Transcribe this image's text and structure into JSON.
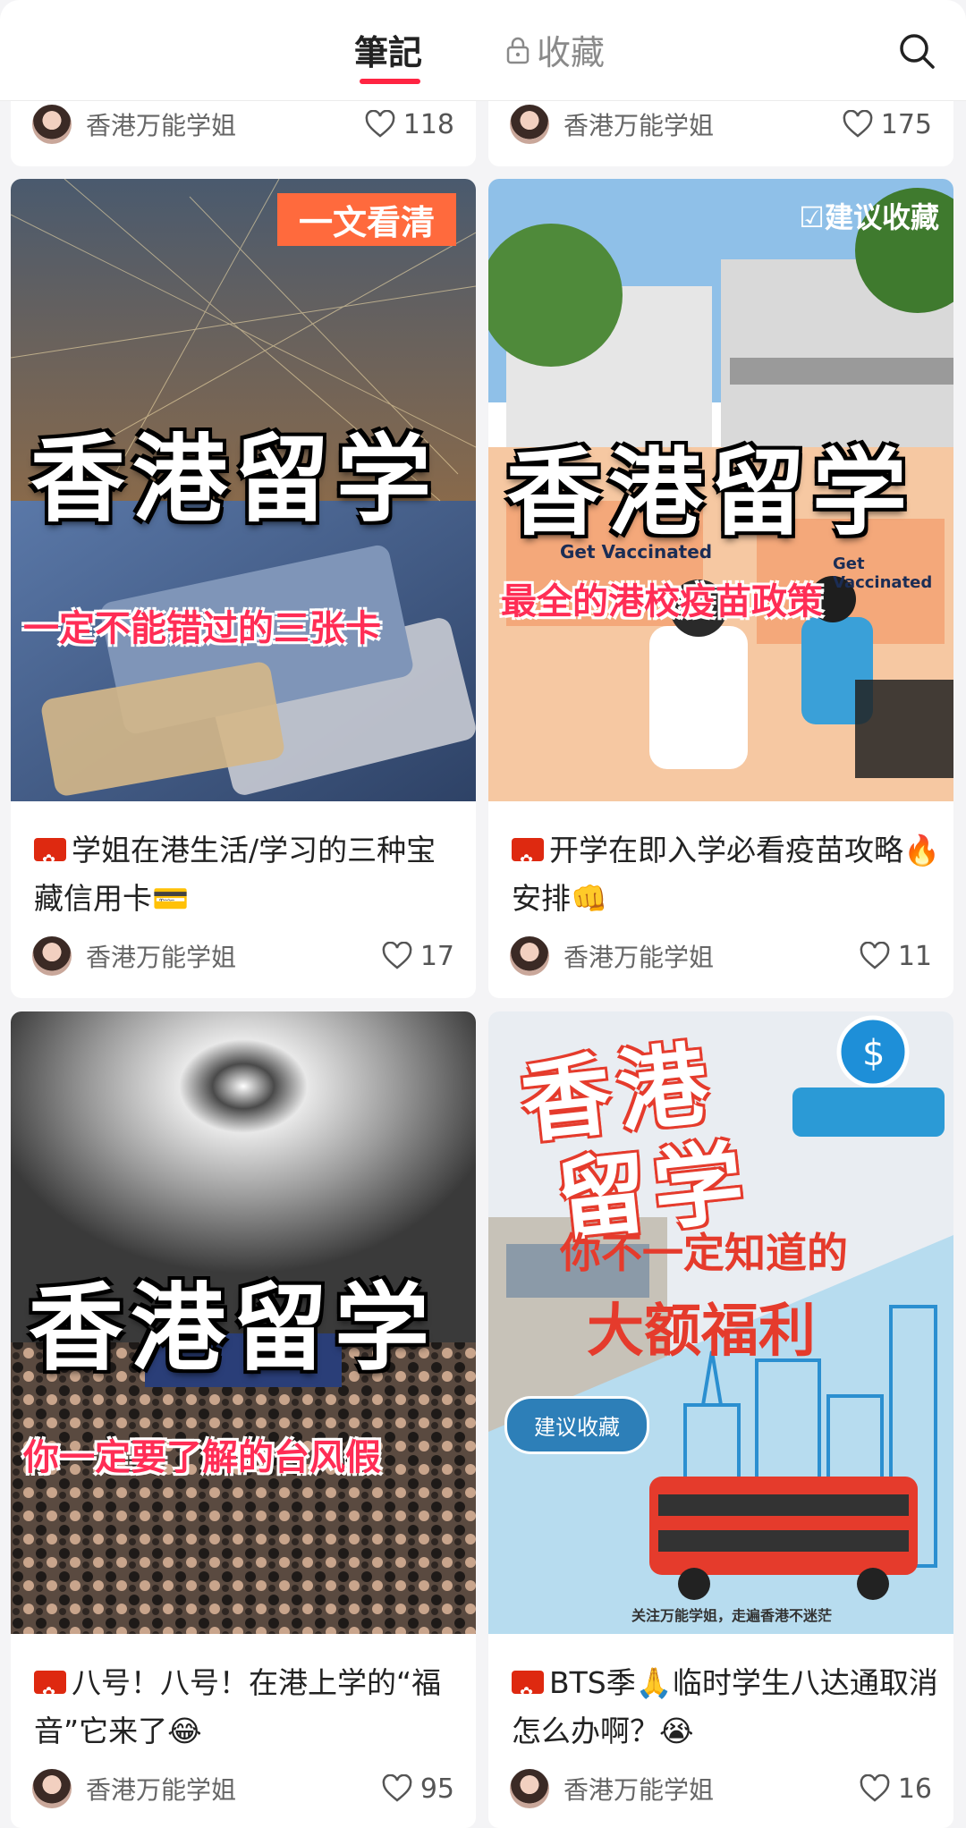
{
  "header": {
    "tab_notes": "筆記",
    "tab_favorites": "收藏"
  },
  "top_row": [
    {
      "author": "香港万能学姐",
      "likes": "118"
    },
    {
      "author": "香港万能学姐",
      "likes": "175"
    }
  ],
  "cards": [
    {
      "thumb_tag": "一文看清",
      "thumb_title": "香港留学",
      "thumb_subtitle": "一定不能错过的三张卡",
      "title": "学姐在港生活/学习的三种宝藏信用卡💳",
      "author": "香港万能学姐",
      "likes": "17"
    },
    {
      "thumb_tag": "☑建议收藏",
      "thumb_title": "香港留学",
      "thumb_subtitle": "最全的港校疫苗政策",
      "thumb_sign_left": "Get Vaccinated",
      "thumb_sign_right": "Get Vaccinated",
      "title": "开学在即入学必看疫苗攻略🔥安排👊",
      "author": "香港万能学姐",
      "likes": "11"
    },
    {
      "thumb_title": "香港留学",
      "thumb_subtitle": "你一定要了解的台风假",
      "title": "八号！八号！在港上学的“福音”它来了😂",
      "author": "香港万能学姐",
      "likes": "95"
    },
    {
      "thumb_title_line1": "香港",
      "thumb_title_line2": "留学",
      "thumb_subtitle_line1": "你不一定知道的",
      "thumb_subtitle_line2": "大额福利",
      "thumb_pill": "建议收藏",
      "thumb_footer": "关注万能学姐，走遍香港不迷茫",
      "title": "BTS季🙏临时学生八达通取消怎么办啊？😭",
      "author": "香港万能学姐",
      "likes": "16"
    }
  ],
  "colors": {
    "accent": "#ff2442",
    "card_bg": "#ffffff",
    "page_bg": "#f4f4f6"
  },
  "icons": [
    "lock-icon",
    "search-icon",
    "heart-icon",
    "hk-flag-icon",
    "avatar"
  ]
}
